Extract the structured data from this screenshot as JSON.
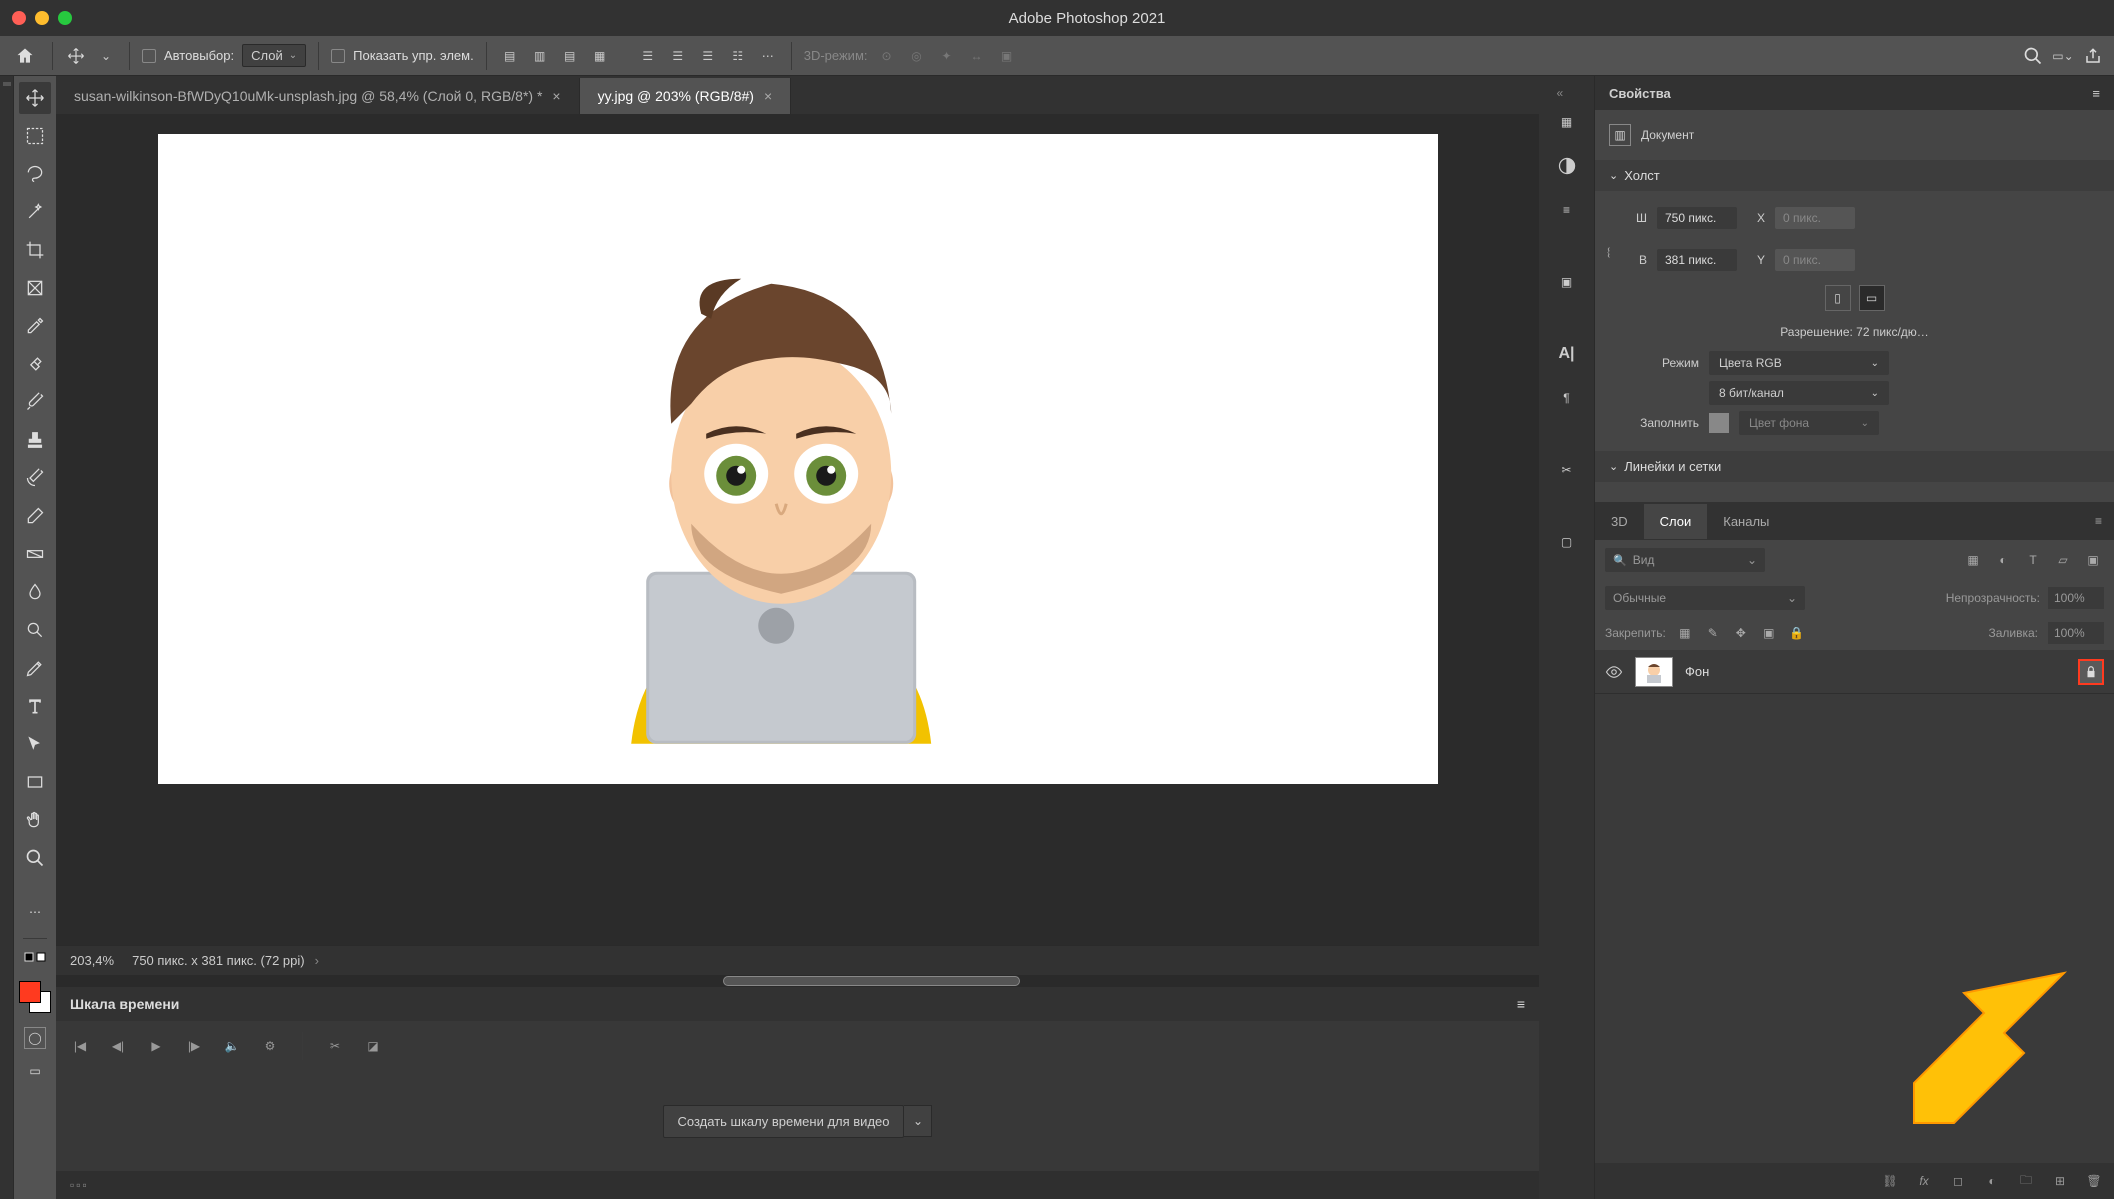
{
  "titlebar": {
    "title": "Adobe Photoshop 2021"
  },
  "optionsbar": {
    "autoselect_label": "Автовыбор:",
    "autoselect_target": "Слой",
    "show_controls_label": "Показать упр. элем.",
    "mode3d_label": "3D-режим:"
  },
  "tabs": [
    {
      "label": "susan-wilkinson-BfWDyQ10uMk-unsplash.jpg @ 58,4% (Слой 0, RGB/8*) *"
    },
    {
      "label": "yy.jpg @ 203% (RGB/8#)"
    }
  ],
  "statusbar": {
    "zoom": "203,4%",
    "dims": "750 пикс. x 381 пикс. (72 ppi)"
  },
  "timeline": {
    "title": "Шкала времени",
    "create_btn": "Создать шкалу времени для видео"
  },
  "properties": {
    "panel_title": "Свойства",
    "doc_label": "Документ",
    "canvas_section": "Холст",
    "w_label": "Ш",
    "w_value": "750 пикс.",
    "h_label": "В",
    "h_value": "381 пикс.",
    "x_label": "X",
    "x_value": "0 пикс.",
    "y_label": "Y",
    "y_value": "0 пикс.",
    "resolution": "Разрешение: 72 пикс/дю…",
    "mode_label": "Режим",
    "mode_value": "Цвета RGB",
    "depth_value": "8 бит/канал",
    "fill_label": "Заполнить",
    "fill_value": "Цвет фона",
    "rulers_section": "Линейки и сетки"
  },
  "layers": {
    "tab_3d": "3D",
    "tab_layers": "Слои",
    "tab_channels": "Каналы",
    "filter_kind": "Вид",
    "blend_mode": "Обычные",
    "opacity_label": "Непрозрачность:",
    "opacity_value": "100%",
    "lock_label": "Закрепить:",
    "fill_label": "Заливка:",
    "fill_value": "100%",
    "layer0": {
      "name": "Фон"
    }
  }
}
